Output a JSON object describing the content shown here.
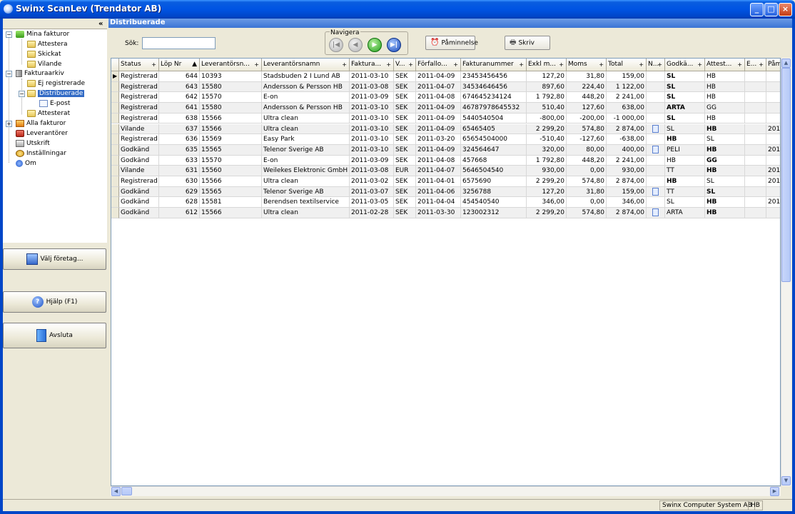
{
  "window": {
    "title": "Swinx ScanLev (Trendator AB)",
    "controls": [
      "_",
      "□",
      "×"
    ]
  },
  "sidebar": {
    "collapse_glyph": "«",
    "tree": [
      {
        "label": "Mina fakturor",
        "children": [
          "Attestera",
          "Skickat",
          "Vilande"
        ]
      },
      {
        "label": "Fakturaarkiv",
        "children": [
          "Ej registrerade",
          "Distribuerade",
          "E-post",
          "Attesterat"
        ]
      },
      {
        "label": "Alla fakturor"
      },
      {
        "label": "Leverantörer"
      },
      {
        "label": "Utskrift"
      },
      {
        "label": "Inställningar"
      },
      {
        "label": "Om"
      }
    ],
    "selected": "Distribuerade",
    "buttons": {
      "company": "Välj företag...",
      "help": "Hjälp (F1)",
      "exit": "Avsluta"
    }
  },
  "panel": {
    "title": "Distribuerade"
  },
  "toolbar": {
    "search_label": "Sök:",
    "search_value": "",
    "nav_label": "Navigera",
    "reminder_label": "Påminnelse",
    "print_label": "Skriv"
  },
  "grid": {
    "columns": [
      "Status",
      "Löp Nr",
      "Leverantörsn...",
      "Leverantörsnamn",
      "Faktura...",
      "V...",
      "Förfallo...",
      "Fakturanummer",
      "Exkl m...",
      "Moms",
      "Total",
      "N...",
      "Godkä...",
      "Attest...",
      "E...",
      "Påm"
    ],
    "rows": [
      [
        "Registrerad",
        "644",
        "10393",
        "Stadsbuden 2 I Lund AB",
        "2011-03-10",
        "SEK",
        "2011-04-09",
        "23453456456",
        "127,20",
        "31,80",
        "159,00",
        "",
        "SL",
        "HB",
        "",
        ""
      ],
      [
        "Registrerad",
        "643",
        "15580",
        "Andersson & Persson HB",
        "2011-03-08",
        "SEK",
        "2011-04-07",
        "34534646456",
        "897,60",
        "224,40",
        "1 122,00",
        "",
        "SL",
        "HB",
        "",
        ""
      ],
      [
        "Registrerad",
        "642",
        "15570",
        "E-on",
        "2011-03-09",
        "SEK",
        "2011-04-08",
        "674645234124",
        "1 792,80",
        "448,20",
        "2 241,00",
        "",
        "SL",
        "HB",
        "",
        ""
      ],
      [
        "Registrerad",
        "641",
        "15580",
        "Andersson & Persson HB",
        "2011-03-10",
        "SEK",
        "2011-04-09",
        "46787978645532",
        "510,40",
        "127,60",
        "638,00",
        "",
        "ARTA",
        "GG",
        "",
        ""
      ],
      [
        "Registrerad",
        "638",
        "15566",
        "Ultra clean",
        "2011-03-10",
        "SEK",
        "2011-04-09",
        "5440540504",
        "-800,00",
        "-200,00",
        "-1 000,00",
        "",
        "SL",
        "HB",
        "",
        ""
      ],
      [
        "Vilande",
        "637",
        "15566",
        "Ultra clean",
        "2011-03-10",
        "SEK",
        "2011-04-09",
        "65465405",
        "2 299,20",
        "574,80",
        "2 874,00",
        "note",
        "SL",
        "HB",
        "",
        "201"
      ],
      [
        "Registrerad",
        "636",
        "15569",
        "Easy Park",
        "2011-03-10",
        "SEK",
        "2011-03-20",
        "65654504000",
        "-510,40",
        "-127,60",
        "-638,00",
        "",
        "HB",
        "SL",
        "",
        ""
      ],
      [
        "Godkänd",
        "635",
        "15565",
        "Telenor Sverige AB",
        "2011-03-10",
        "SEK",
        "2011-04-09",
        "324564647",
        "320,00",
        "80,00",
        "400,00",
        "note",
        "PELI",
        "HB",
        "",
        "201"
      ],
      [
        "Godkänd",
        "633",
        "15570",
        "E-on",
        "2011-03-09",
        "SEK",
        "2011-04-08",
        "457668",
        "1 792,80",
        "448,20",
        "2 241,00",
        "",
        "HB",
        "GG",
        "",
        ""
      ],
      [
        "Vilande",
        "631",
        "15560",
        "Weilekes Elektronic GmbH",
        "2011-03-08",
        "EUR",
        "2011-04-07",
        "5646504540",
        "930,00",
        "0,00",
        "930,00",
        "",
        "TT",
        "HB",
        "",
        "201"
      ],
      [
        "Registrerad",
        "630",
        "15566",
        "Ultra clean",
        "2011-03-02",
        "SEK",
        "2011-04-01",
        "6575690",
        "2 299,20",
        "574,80",
        "2 874,00",
        "",
        "HB",
        "SL",
        "",
        "201"
      ],
      [
        "Godkänd",
        "629",
        "15565",
        "Telenor Sverige AB",
        "2011-03-07",
        "SEK",
        "2011-04-06",
        "3256788",
        "127,20",
        "31,80",
        "159,00",
        "note",
        "TT",
        "SL",
        "",
        ""
      ],
      [
        "Godkänd",
        "628",
        "15581",
        "Berendsen textilservice",
        "2011-03-05",
        "SEK",
        "2011-04-04",
        "454540540",
        "346,00",
        "0,00",
        "346,00",
        "",
        "SL",
        "HB",
        "",
        "201"
      ],
      [
        "Godkänd",
        "612",
        "15566",
        "Ultra clean",
        "2011-02-28",
        "SEK",
        "2011-03-30",
        "123002312",
        "2 299,20",
        "574,80",
        "2 874,00",
        "note",
        "ARTA",
        "HB",
        "",
        ""
      ]
    ],
    "bold_cells": [
      [
        0,
        12
      ],
      [
        1,
        12
      ],
      [
        2,
        12
      ],
      [
        3,
        12
      ],
      [
        4,
        12
      ],
      [
        5,
        13
      ],
      [
        6,
        12
      ],
      [
        7,
        13
      ],
      [
        8,
        13
      ],
      [
        9,
        13
      ],
      [
        10,
        12
      ],
      [
        11,
        13
      ],
      [
        12,
        13
      ],
      [
        13,
        13
      ]
    ]
  },
  "statusbar": {
    "company": "Swinx Computer System AB",
    "user": "HB"
  }
}
